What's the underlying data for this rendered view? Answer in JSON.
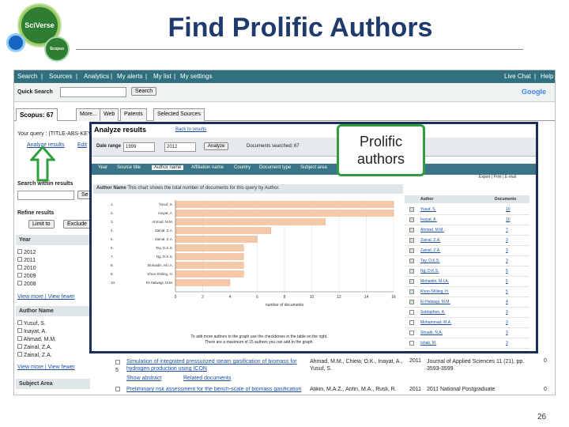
{
  "slide": {
    "title": "Find Prolific Authors",
    "logo_sciverse": "SciVerse",
    "logo_scopus": "Scopus",
    "page_number": "26",
    "callout_line1": "Prolific",
    "callout_line2": "authors"
  },
  "nav": {
    "left": [
      "Search",
      "|",
      "Sources",
      "|",
      "Analytics",
      "|",
      "My alerts",
      "|",
      "My list",
      "|",
      "My settings"
    ],
    "right": [
      "Live Chat",
      "|",
      "Help"
    ]
  },
  "quick_search": {
    "label": "Quick Search",
    "button": "Search",
    "google": "Google"
  },
  "tabs": [
    "Scopus: 67",
    "More...",
    "Web",
    "Patents",
    "Selected Sources"
  ],
  "left_panel": {
    "your_query": "Your query : (TITLE-ABS-KEY(",
    "analyze_link": "Analyze results",
    "edit_link": "Edit",
    "search_within": "Search within results",
    "search_btn": "Se",
    "refine": "Refine results",
    "limit_btn": "Limit to",
    "exclude_btn": "Exclude",
    "year_header": "Year",
    "years": [
      "2012",
      "2011",
      "2010",
      "2009",
      "2008"
    ],
    "view_more": "View more | View fewer",
    "author_header": "Author Name",
    "authors": [
      "Yusuf, S.",
      "Inayat, A.",
      "Ahmad, M.M.",
      "Zainal, Z.A.",
      "Zainal, Z.A."
    ],
    "view_more2": "View more | View fewer",
    "subject_header": "Subject Area"
  },
  "results": [
    {
      "num": "5",
      "title": "Simulation of integrated pressurized steam gasification of biomass for hydrogen production using ICON",
      "authors": "Ahmad, M.M., Chiew, O.K., Inayat, A., Yusuf, S.",
      "year": "2011",
      "source": "Journal of Applied Sciences 11 (21), pp. 3593-3599",
      "cited": "0",
      "show_abstract": "Show abstract",
      "related": "Related documents"
    },
    {
      "num": "",
      "title": "Preliminary risk assessment for the bench-scale of biomass gasification",
      "authors": "Atikin, M.A.Z., Arifin, M.A., Rusli, R.",
      "year": "2011",
      "source": "2011 National Postgraduate",
      "cited": "0"
    }
  ],
  "popup": {
    "title": "Analyze results",
    "back_link": "Back to results",
    "date_label": "Date range",
    "date_from": "1999",
    "date_to": "2012",
    "analyze_btn": "Analyze",
    "doc_count": "Documents searched: 67",
    "tabs": [
      "Year",
      "Source title",
      "Author name",
      "Affiliation name",
      "Country",
      "Document type",
      "Subject area"
    ],
    "chart_header": "Author Name",
    "chart_note": "This chart shows the total number of documents for this query by Author.",
    "table_headers": [
      "Author",
      "Documents"
    ],
    "export": "Export",
    "print": "Print",
    "email": "E-mail",
    "footer1": "To add more authors to the graph use the checkboxes in the table on the right.",
    "footer2": "There are a maximum of 15 authors you can add to the graph.",
    "xlabel": "number of documents",
    "authors": [
      {
        "rank": "1.",
        "name": "Yusuf, S.",
        "docs": "10",
        "checked": true
      },
      {
        "rank": "2.",
        "name": "Inayat, A.",
        "docs": "10",
        "checked": true
      },
      {
        "rank": "3.",
        "name": "Ahmad, M.M.",
        "docs": "7",
        "checked": true
      },
      {
        "rank": "4.",
        "name": "Zainal, Z.A.",
        "docs": "3",
        "checked": true
      },
      {
        "rank": "5.",
        "name": "Zainal, Z.A.",
        "docs": "3",
        "checked": true
      },
      {
        "rank": "6.",
        "name": "Tay, D.K.S.",
        "docs": "3",
        "checked": true
      },
      {
        "rank": "7.",
        "name": "Ng, D.K.S.",
        "docs": "5",
        "checked": true
      },
      {
        "rank": "8.",
        "name": "Mohaidin, M.I.A.",
        "docs": "5",
        "checked": true
      },
      {
        "rank": "9.",
        "name": "Khoo-Shiling, H.",
        "docs": "5",
        "checked": true
      },
      {
        "rank": "10.",
        "name": "El-Halwagi, M.M.",
        "docs": "4",
        "checked": true
      },
      {
        "rank": "",
        "name": "Sotriaphon, A.",
        "docs": "3",
        "checked": false
      },
      {
        "rank": "",
        "name": "Mohammad, M.A.",
        "docs": "3",
        "checked": false
      },
      {
        "rank": "",
        "name": "Shuaib, N.A.",
        "docs": "3",
        "checked": false
      },
      {
        "rank": "",
        "name": "Ishak, M.",
        "docs": "3",
        "checked": false
      }
    ]
  },
  "chart_data": {
    "type": "bar",
    "orientation": "horizontal",
    "categories": [
      "Yusuf, S.",
      "Inayat, A.",
      "Ahmad, M.M.",
      "Zainal, Z.A.",
      "Zainal, Z.A.",
      "Tay, D.K.S.",
      "Ng, D.K.S.",
      "Mohaidin, M.I.A.",
      "Khoo-Shiling, H.",
      "El-Halwagi, M.M."
    ],
    "values": [
      16,
      16,
      11,
      7,
      6,
      5,
      5,
      5,
      5,
      4
    ],
    "xlabel": "number of documents",
    "xticks": [
      "0",
      "2",
      "4",
      "6",
      "8",
      "10",
      "12",
      "14",
      "16"
    ],
    "xlim": [
      0,
      16
    ],
    "bar_color": "#f5c9a8",
    "grid": true
  },
  "colors": {
    "nav": "#2f6f7e",
    "popup_border": "#1c2e5a",
    "callout_border": "#2e9e3e",
    "title": "#1f3a6d"
  }
}
